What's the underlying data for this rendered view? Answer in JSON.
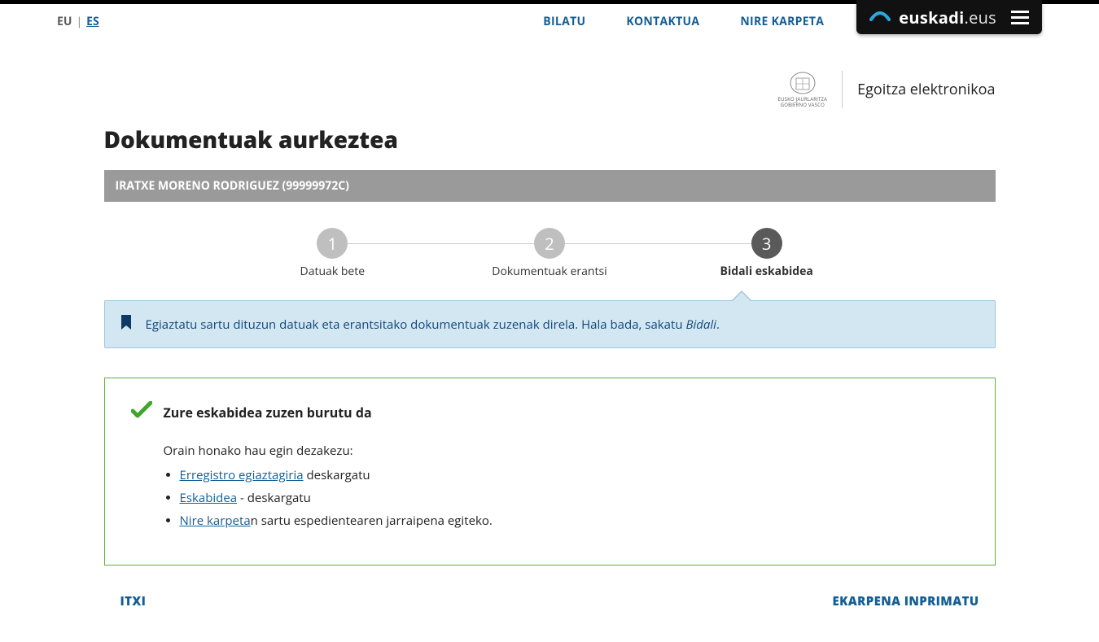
{
  "header": {
    "lang": {
      "eu": "EU",
      "es": "ES"
    },
    "nav": {
      "bilatu": "BILATU",
      "kontaktua": "KONTAKTUA",
      "nire_karpeta": "NIRE KARPETA"
    },
    "brand": {
      "bold": "euskadi",
      "light": ".eus"
    }
  },
  "logo_row": {
    "ej_lines": "EUSKO JAURLARITZA",
    "ej_lines2": "GOBIERNO VASCO",
    "egoitza": "Egoitza elektronikoa"
  },
  "page": {
    "title": "Dokumentuak aurkeztea",
    "user_bar": "IRATXE MORENO RODRIGUEZ (99999972C)"
  },
  "steps": [
    {
      "num": "1",
      "label": "Datuak bete"
    },
    {
      "num": "2",
      "label": "Dokumentuak erantsi"
    },
    {
      "num": "3",
      "label": "Bidali eskabidea"
    }
  ],
  "banner": {
    "text_pre": "Egiaztatu sartu dituzun datuak eta erantsitako dokumentuak zuzenak direla. Hala bada, sakatu ",
    "text_em": "Bidali",
    "text_post": "."
  },
  "success": {
    "title": "Zure eskabidea zuzen burutu da",
    "intro": "Orain honako hau egin dezakezu:",
    "items": [
      {
        "link": "Erregistro egiaztagiria",
        "suffix": " deskargatu"
      },
      {
        "link": "Eskabidea",
        "suffix": " - deskargatu"
      },
      {
        "link": "Nire karpeta",
        "suffix": "n sartu espedientearen jarraipena egiteko."
      }
    ]
  },
  "actions": {
    "close": "ITXI",
    "print": "EKARPENA INPRIMATU"
  }
}
